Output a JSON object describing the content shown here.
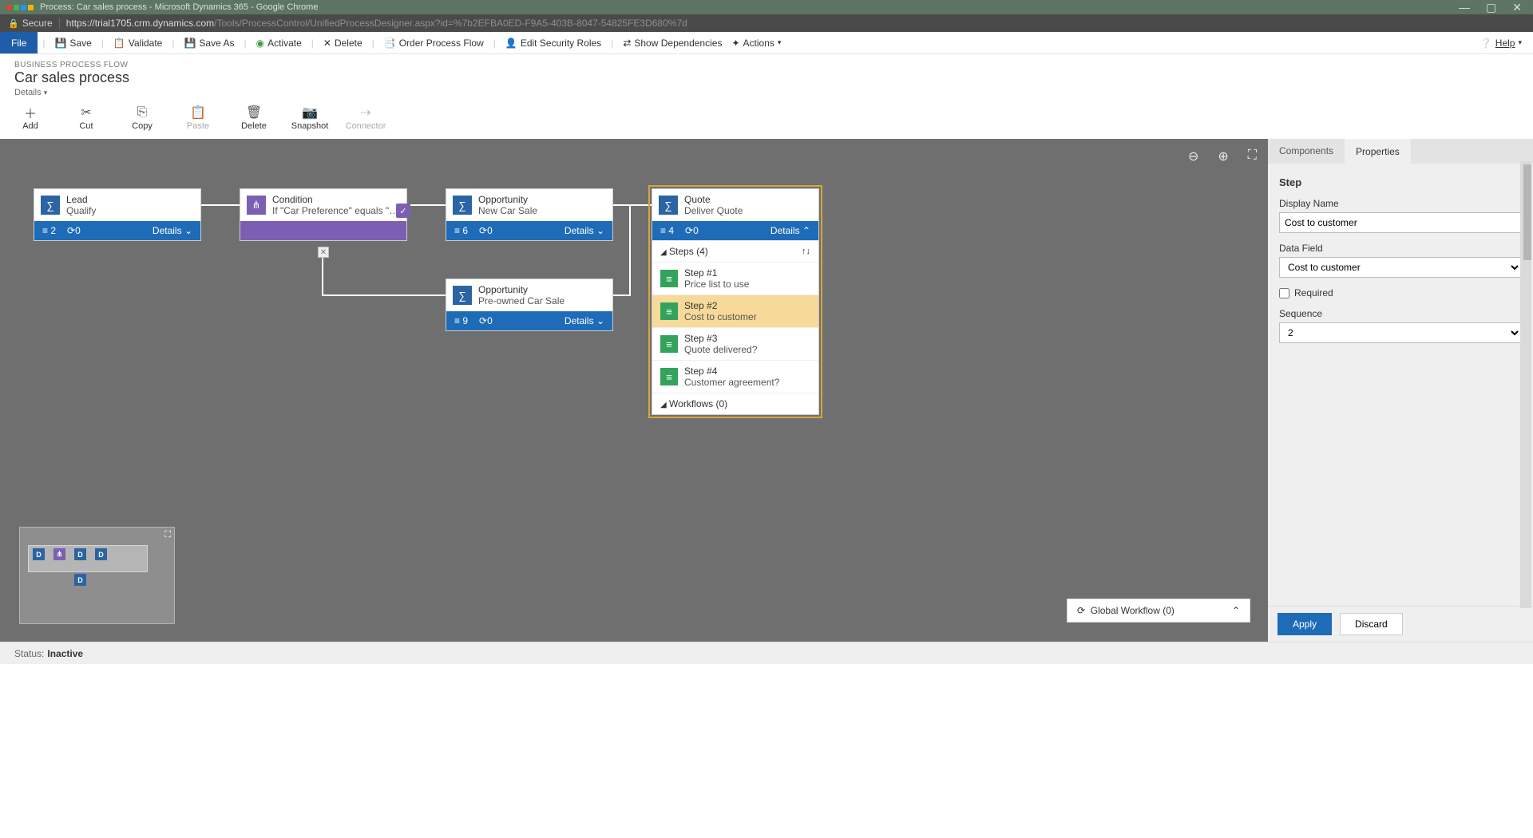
{
  "window": {
    "title": "Process: Car sales process - Microsoft Dynamics 365 - Google Chrome"
  },
  "address": {
    "secure_label": "Secure",
    "host": "https://trial1705.crm.dynamics.com",
    "path": "/Tools/ProcessControl/UnifiedProcessDesigner.aspx?id=%7b2EFBA0ED-F9A5-403B-8047-54825FE3D680%7d"
  },
  "menu": {
    "file": "File",
    "save": "Save",
    "save_as": "Save As",
    "validate": "Validate",
    "activate": "Activate",
    "delete": "Delete",
    "order": "Order Process Flow",
    "security": "Edit Security Roles",
    "deps": "Show Dependencies",
    "actions": "Actions",
    "help": "Help"
  },
  "header": {
    "crumb": "BUSINESS PROCESS FLOW",
    "title": "Car sales process",
    "details": "Details"
  },
  "toolbar": {
    "add": "Add",
    "cut": "Cut",
    "copy": "Copy",
    "paste": "Paste",
    "delete": "Delete",
    "snapshot": "Snapshot",
    "connector": "Connector"
  },
  "canvas": {
    "stages": {
      "lead": {
        "title": "Lead",
        "sub": "Qualify",
        "count": "2",
        "rot": "0",
        "details": "Details"
      },
      "cond": {
        "title": "Condition",
        "sub": "If \"Car Preference\" equals \"New ..."
      },
      "opp1": {
        "title": "Opportunity",
        "sub": "New Car Sale",
        "count": "6",
        "rot": "0",
        "details": "Details"
      },
      "opp2": {
        "title": "Opportunity",
        "sub": "Pre-owned Car Sale",
        "count": "9",
        "rot": "0",
        "details": "Details"
      },
      "quote": {
        "title": "Quote",
        "sub": "Deliver Quote",
        "count": "4",
        "rot": "0",
        "details": "Details",
        "steps_label": "Steps (4)",
        "workflows_label": "Workflows (0)",
        "steps": [
          {
            "label": "Step #1",
            "desc": "Price list to use"
          },
          {
            "label": "Step #2",
            "desc": "Cost to customer"
          },
          {
            "label": "Step #3",
            "desc": "Quote delivered?"
          },
          {
            "label": "Step #4",
            "desc": "Customer agreement?"
          }
        ]
      }
    },
    "global_wf": "Global Workflow (0)"
  },
  "side": {
    "tabs": {
      "components": "Components",
      "properties": "Properties"
    },
    "section": "Step",
    "display_name_label": "Display Name",
    "display_name_value": "Cost to customer",
    "data_field_label": "Data Field",
    "data_field_value": "Cost to customer",
    "required_label": "Required",
    "sequence_label": "Sequence",
    "sequence_value": "2",
    "apply": "Apply",
    "discard": "Discard"
  },
  "status": {
    "label": "Status:",
    "value": "Inactive"
  }
}
